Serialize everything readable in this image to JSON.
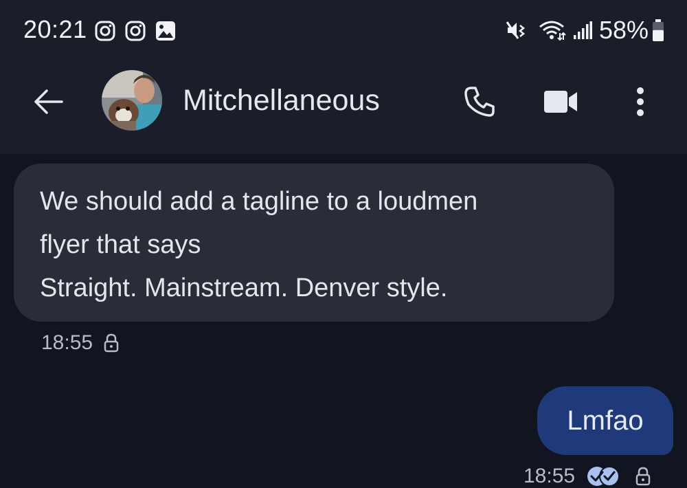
{
  "status_bar": {
    "time": "20:21",
    "left_icons": [
      "instagram-icon",
      "instagram-icon",
      "gallery-icon"
    ],
    "right_icons": [
      "mute-icon",
      "wifi-icon",
      "signal-icon"
    ],
    "battery": "58%",
    "battery_level": 0.58
  },
  "header": {
    "contact_name": "Mitchellaneous",
    "icons": [
      "back-arrow-icon",
      "phone-icon",
      "video-call-icon",
      "more-vert-icon"
    ]
  },
  "messages": [
    {
      "direction": "incoming",
      "lines": [
        "We should add a tagline to a loudmen",
        "flyer that says",
        "Straight. Mainstream. Denver style."
      ],
      "timestamp": "18:55",
      "icons": [
        "lock-icon"
      ]
    },
    {
      "direction": "outgoing",
      "text": "Lmfao",
      "timestamp": "18:55",
      "icons": [
        "read-receipt-icon",
        "lock-icon"
      ]
    }
  ],
  "colors": {
    "background": "#111520",
    "header": "#1b1e29",
    "incoming_bubble": "#2a2d38",
    "outgoing_bubble": "#1f3a7a",
    "read_receipt": "#a9c1f0"
  }
}
